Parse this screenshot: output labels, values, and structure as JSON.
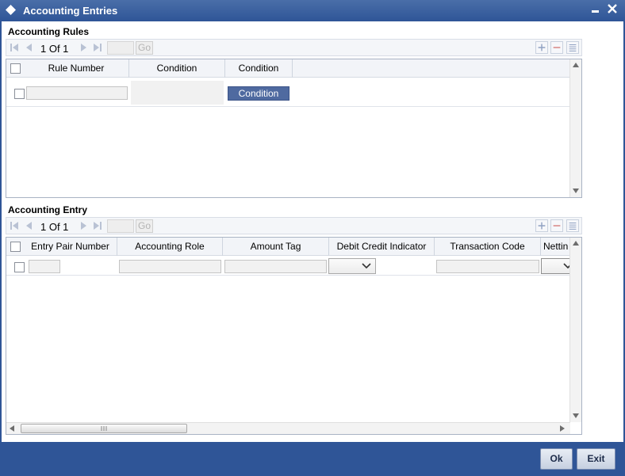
{
  "window": {
    "title": "Accounting Entries"
  },
  "rules_section": {
    "title": "Accounting Rules",
    "pager": {
      "text": "1 Of 1",
      "go_label": "Go"
    },
    "columns": [
      "Rule Number",
      "Condition",
      "Condition"
    ],
    "row": {
      "rule_number": "",
      "condition": "",
      "condition_button": "Condition"
    }
  },
  "entry_section": {
    "title": "Accounting Entry",
    "pager": {
      "text": "1 Of 1",
      "go_label": "Go"
    },
    "columns": [
      "Entry Pair Number",
      "Accounting Role",
      "Amount Tag",
      "Debit Credit Indicator",
      "Transaction Code",
      "Nettin"
    ],
    "row": {
      "entry_pair_number": "",
      "accounting_role": "",
      "amount_tag": "",
      "debit_credit_indicator": "",
      "transaction_code": "",
      "netting": ""
    }
  },
  "footer": {
    "ok_label": "Ok",
    "exit_label": "Exit"
  },
  "colors": {
    "title_bar": "#2f5597",
    "button_blue": "#4f6aa0",
    "border": "#a9b3c4"
  }
}
